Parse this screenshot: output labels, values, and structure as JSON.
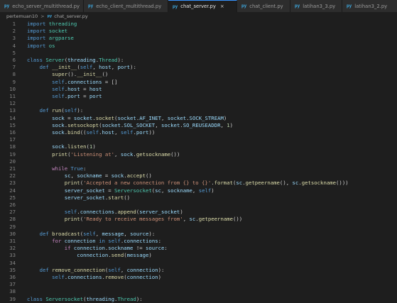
{
  "tabs": [
    {
      "label": "echo_server_multithread.py",
      "active": false
    },
    {
      "label": "echo_client_multithread.py",
      "active": false
    },
    {
      "label": "chat_server.py",
      "active": true
    },
    {
      "label": "chat_client.py",
      "active": false
    },
    {
      "label": "latihan3_3.py",
      "active": false
    },
    {
      "label": "latihan3_2.py",
      "active": false
    }
  ],
  "breadcrumb": {
    "folder": "pertemuan10",
    "file": "chat_server.py"
  },
  "code_lines": [
    "import threading",
    "import socket",
    "import argparse",
    "import os",
    "",
    "class Server(threading.Thread):",
    "    def __init__(self, host, port):",
    "        super().__init__()",
    "        self.connections = []",
    "        self.host = host",
    "        self.port = port",
    "",
    "    def run(self):",
    "        sock = socket.socket(socket.AF_INET, socket.SOCK_STREAM)",
    "        sock.setsockopt(socket.SOL_SOCKET, socket.SO_REUSEADDR, 1)",
    "        sock.bind((self.host, self.port))",
    "",
    "        sock.listen(1)",
    "        print('Listening at', sock.getsockname())",
    "",
    "        while True:",
    "            sc, sockname = sock.accept()",
    "            print('Accepted a new connection from {} to {}'.format(sc.getpeername(), sc.getsockname()))",
    "            server_socket = Serversocket(sc, sockname, self)",
    "            server_socket.start()",
    "",
    "            self.connections.append(server_socket)",
    "            print('Ready to receive messages from', sc.getpeername())",
    "",
    "    def broadcast(self, message, source):",
    "        for connection in self.connections:",
    "            if connection.sockname != source:",
    "                connection.send(message)",
    "",
    "    def remove_connection(self, connection):",
    "        self.connections.remove(connection)",
    "",
    "",
    "class Serversocket(threading.Thread):"
  ]
}
